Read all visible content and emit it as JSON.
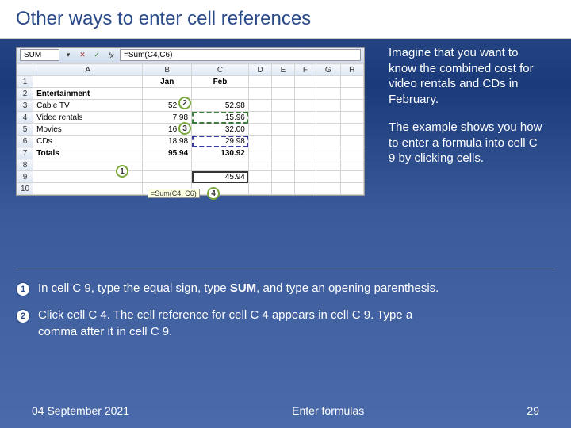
{
  "title": "Other ways to enter cell references",
  "excel": {
    "name_box": "SUM",
    "formula_bar": "=Sum(C4,C6)",
    "cols": [
      "A",
      "B",
      "C",
      "D",
      "E",
      "F",
      "G",
      "H"
    ],
    "col_months": {
      "b": "Jan",
      "c": "Feb"
    },
    "rows": [
      {
        "n": "1",
        "a": ""
      },
      {
        "n": "2",
        "a": "Entertainment"
      },
      {
        "n": "3",
        "a": "Cable TV",
        "b": "52.98",
        "c": "52.98"
      },
      {
        "n": "4",
        "a": "Video rentals",
        "b": "7.98",
        "c": "15.96"
      },
      {
        "n": "5",
        "a": "Movies",
        "b": "16.00",
        "c": "32.00"
      },
      {
        "n": "6",
        "a": "CDs",
        "b": "18.98",
        "c": "29.98"
      },
      {
        "n": "7",
        "a": "Totals",
        "b": "95.94",
        "c": "130.92"
      },
      {
        "n": "8",
        "a": ""
      },
      {
        "n": "9",
        "a": "",
        "c": "45.94"
      },
      {
        "n": "10",
        "a": ""
      }
    ],
    "c9_tooltip": "=Sum(C4, C6)"
  },
  "side": {
    "p1": "Imagine that you want to know the combined cost for video rentals and CDs in February.",
    "p2": "The example shows you how to enter a formula into cell C 9 by clicking cells."
  },
  "steps": {
    "s1": {
      "pre": "In cell C 9, type the equal sign, type ",
      "bold": "SUM",
      "post": ", and type an opening parenthesis."
    },
    "s2": "Click cell C 4. The cell reference for cell C 4 appears in cell C 9. Type a comma after it in cell C 9."
  },
  "footer": {
    "date": "04 September 2021",
    "center": "Enter formulas",
    "page": "29"
  },
  "callouts": {
    "c1": "1",
    "c2": "2",
    "c3": "3",
    "c4": "4"
  }
}
